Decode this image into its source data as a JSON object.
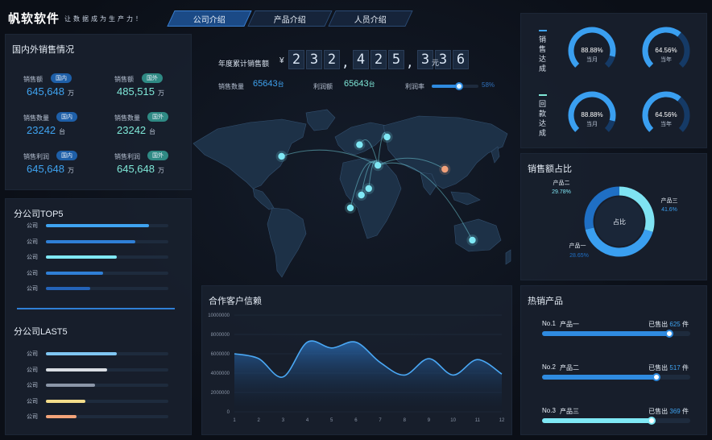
{
  "header": {
    "brand": "帆软软件",
    "slogan": "让数据成为生产力！",
    "tabs": [
      {
        "label": "公司介绍",
        "active": true
      },
      {
        "label": "产品介绍",
        "active": false
      },
      {
        "label": "人员介绍",
        "active": false
      }
    ]
  },
  "domestic_foreign": {
    "title": "国内外销售情况",
    "items": [
      {
        "label": "销售额",
        "tag": "国内",
        "value": "645,648",
        "unit": "万"
      },
      {
        "label": "销售额",
        "tag": "国外",
        "value": "485,515",
        "unit": "万"
      },
      {
        "label": "销售数量",
        "tag": "国内",
        "value": "23242",
        "unit": "台"
      },
      {
        "label": "销售数量",
        "tag": "国外",
        "value": "23242",
        "unit": "台"
      },
      {
        "label": "销售利润",
        "tag": "国内",
        "value": "645,648",
        "unit": "万"
      },
      {
        "label": "销售利润",
        "tag": "国外",
        "value": "645,648",
        "unit": "万"
      }
    ]
  },
  "annual": {
    "label": "年度累计销售额",
    "currency": "¥",
    "digits": [
      "2",
      "3",
      "2",
      "4",
      "2",
      "5",
      "3",
      "3",
      "6"
    ],
    "unit": "元",
    "qty_label": "销售数量",
    "qty_value": "65643",
    "qty_unit": "台",
    "profit_label": "利润额",
    "profit_value": "65643",
    "profit_unit": "台",
    "rate_label": "利润率",
    "rate_value": "58%",
    "rate_fraction": 0.58
  },
  "top5": {
    "title": "分公司TOP5",
    "rows": [
      {
        "label": "公司",
        "fraction": 0.84,
        "color": "#3fa3f0"
      },
      {
        "label": "公司",
        "fraction": 0.73,
        "color": "#2f7fd6"
      },
      {
        "label": "公司",
        "fraction": 0.58,
        "color": "#7fe8f5"
      },
      {
        "label": "公司",
        "fraction": 0.47,
        "color": "#2f7fd6"
      },
      {
        "label": "公司",
        "fraction": 0.36,
        "color": "#2463b8"
      }
    ]
  },
  "last5": {
    "title": "分公司LAST5",
    "rows": [
      {
        "label": "公司",
        "fraction": 0.58,
        "color": "#7fc6f2"
      },
      {
        "label": "公司",
        "fraction": 0.5,
        "color": "#d9dde3"
      },
      {
        "label": "公司",
        "fraction": 0.4,
        "color": "#8b96a8"
      },
      {
        "label": "公司",
        "fraction": 0.32,
        "color": "#f3dc8a"
      },
      {
        "label": "公司",
        "fraction": 0.25,
        "color": "#f2a37a"
      }
    ]
  },
  "gauges": {
    "sales_label": "销售达成",
    "payment_label": "回款达成",
    "items": [
      {
        "value": "88.88%",
        "sub": "当月",
        "fraction": 0.8888
      },
      {
        "value": "64.56%",
        "sub": "当年",
        "fraction": 0.6456
      },
      {
        "value": "88.88%",
        "sub": "当月",
        "fraction": 0.8888
      },
      {
        "value": "64.56%",
        "sub": "当年",
        "fraction": 0.6456
      }
    ]
  },
  "share": {
    "title": "销售额占比",
    "center_label": "占比",
    "slices": [
      {
        "name": "产品一",
        "percent": "28.65%",
        "value": 28.65,
        "color": "#1f6fc4"
      },
      {
        "name": "产品二",
        "percent": "29.78%",
        "value": 29.78,
        "color": "#7fe3f2"
      },
      {
        "name": "产品三",
        "percent": "41.6%",
        "value": 41.6,
        "color": "#3a9ff0"
      }
    ]
  },
  "trust": {
    "title": "合作客户信赖"
  },
  "hot": {
    "title": "热销产品",
    "sold_label": "已售出",
    "unit": "件",
    "rows": [
      {
        "rank": "No.1",
        "name": "产品一",
        "sold": "625",
        "fraction": 0.86,
        "color": "#2f8be0"
      },
      {
        "rank": "No.2",
        "name": "产品二",
        "sold": "517",
        "fraction": 0.77,
        "color": "#2f8be0"
      },
      {
        "rank": "No.3",
        "name": "产品三",
        "sold": "369",
        "fraction": 0.74,
        "color": "#7fe8f5"
      }
    ]
  },
  "chart_data": {
    "type": "area",
    "title": "合作客户信赖",
    "x": [
      1,
      2,
      3,
      4,
      5,
      6,
      7,
      8,
      9,
      10,
      11,
      12
    ],
    "series": [
      {
        "values": [
          6000000,
          5500000,
          3600000,
          7200000,
          6600000,
          7200000,
          5100000,
          3800000,
          5500000,
          3800000,
          5400000,
          3900000
        ]
      }
    ],
    "yticks": [
      "10000000",
      "8000000",
      "6000000",
      "4000000",
      "2000000",
      "0"
    ],
    "ylim": [
      0,
      10000000
    ],
    "grid": true
  },
  "map": {
    "points": [
      {
        "lon": -75,
        "lat": 40,
        "color": "#7fe8f5"
      },
      {
        "lon": 10,
        "lat": 49,
        "color": "#7fe8f5"
      },
      {
        "lon": 40,
        "lat": 55,
        "color": "#7fe8f5"
      },
      {
        "lon": 30,
        "lat": 33,
        "color": "#7fe8f5"
      },
      {
        "lon": 20,
        "lat": 15,
        "color": "#7fe8f5"
      },
      {
        "lon": 12,
        "lat": 10,
        "color": "#7fe8f5"
      },
      {
        "lon": 0,
        "lat": 0,
        "color": "#7fe8f5"
      },
      {
        "lon": 103,
        "lat": 30,
        "color": "#f0a07a"
      },
      {
        "lon": 133,
        "lat": -25,
        "color": "#7fe8f5"
      }
    ]
  }
}
